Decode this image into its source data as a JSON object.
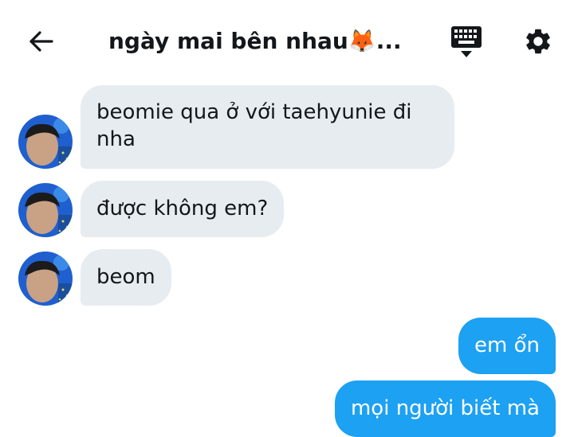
{
  "header": {
    "title": "ngày mai bên nhau🦊...",
    "back_icon": "arrow-left-icon",
    "keyboard_icon": "keyboard-icon",
    "settings_icon": "gear-icon"
  },
  "colors": {
    "incoming_bubble": "#e6ecf0",
    "outgoing_bubble": "#1da1f2",
    "text": "#14171a",
    "outgoing_text": "#ffffff"
  },
  "messages": [
    {
      "direction": "incoming",
      "text": "beomie qua ở với taehyunie đi nha"
    },
    {
      "direction": "incoming",
      "text": "được không em?"
    },
    {
      "direction": "incoming",
      "text": "beom"
    },
    {
      "direction": "outgoing",
      "text": "em ổn"
    },
    {
      "direction": "outgoing",
      "text": "mọi người biết mà"
    }
  ]
}
